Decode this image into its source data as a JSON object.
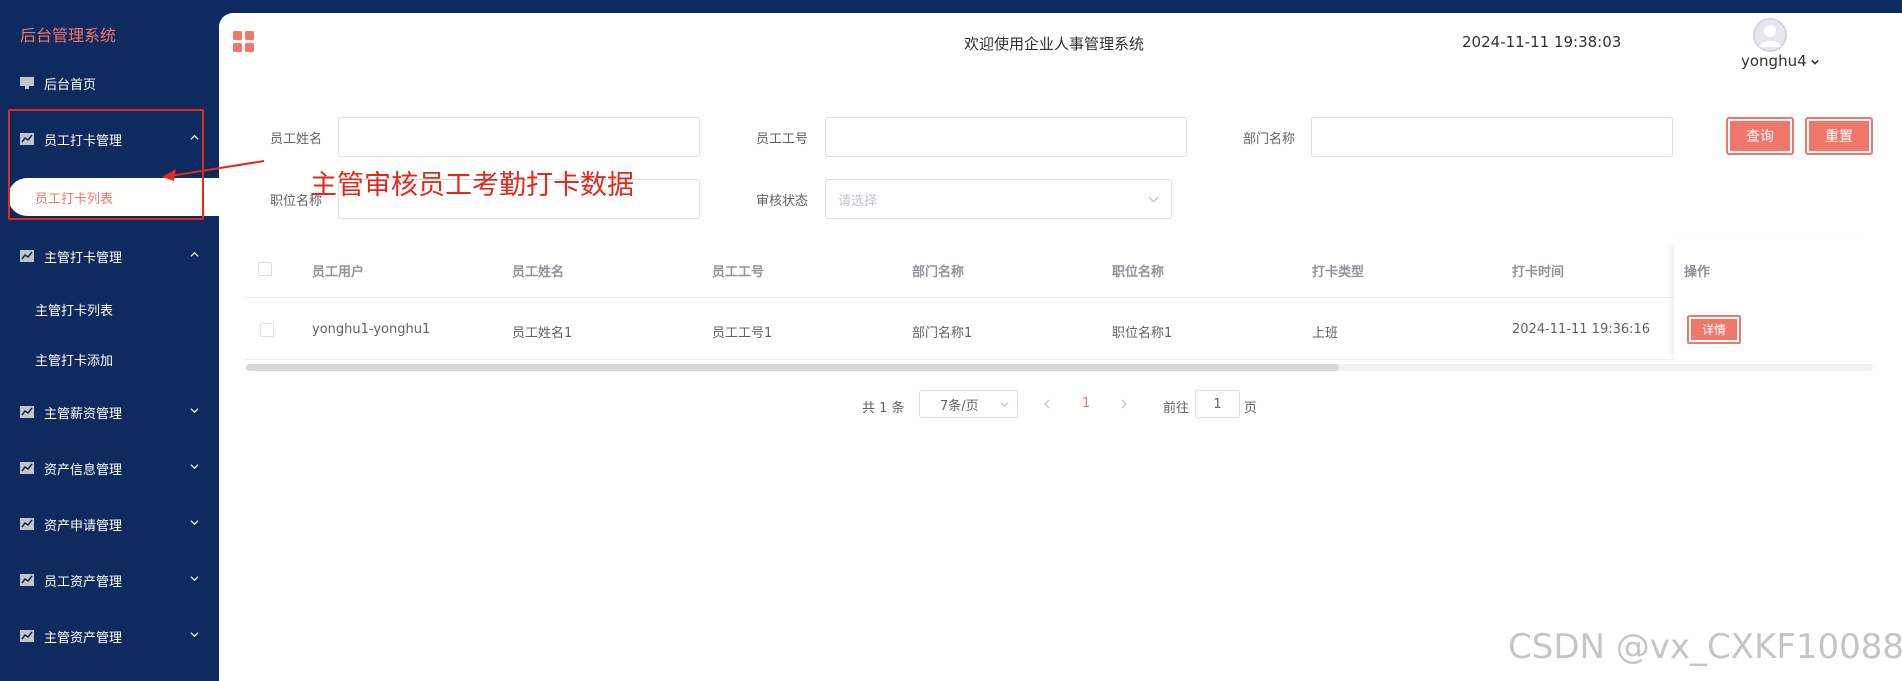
{
  "sidebar": {
    "brand": "后台管理系统",
    "items": [
      {
        "label": "后台首页",
        "icon": "monitor-icon"
      },
      {
        "label": "员工打卡管理",
        "icon": "chart-icon",
        "expanded": true,
        "children": [
          {
            "label": "员工打卡列表",
            "active": true
          }
        ]
      },
      {
        "label": "主管打卡管理",
        "icon": "chart-icon",
        "expanded": true,
        "children": [
          {
            "label": "主管打卡列表"
          },
          {
            "label": "主管打卡添加"
          }
        ]
      },
      {
        "label": "主管薪资管理",
        "icon": "chart-icon"
      },
      {
        "label": "资产信息管理",
        "icon": "chart-icon"
      },
      {
        "label": "资产申请管理",
        "icon": "chart-icon"
      },
      {
        "label": "员工资产管理",
        "icon": "chart-icon"
      },
      {
        "label": "主管资产管理",
        "icon": "chart-icon"
      }
    ]
  },
  "header": {
    "welcome": "欢迎使用企业人事管理系统",
    "datetime": "2024-11-11 19:38:03",
    "username": "yonghu4"
  },
  "search": {
    "employee_name_label": "员工姓名",
    "employee_no_label": "员工工号",
    "dept_label": "部门名称",
    "position_label": "职位名称",
    "status_label": "审核状态",
    "status_placeholder": "请选择",
    "query_button": "查询",
    "reset_button": "重置"
  },
  "annotation": {
    "text": "主管审核员工考勤打卡数据"
  },
  "table": {
    "columns": [
      "员工用户",
      "员工姓名",
      "员工工号",
      "部门名称",
      "职位名称",
      "打卡类型",
      "打卡时间",
      "操作"
    ],
    "rows": [
      {
        "user": "yonghu1-yonghu1",
        "name": "员工姓名1",
        "no": "员工工号1",
        "dept": "部门名称1",
        "position": "职位名称1",
        "type": "上班",
        "time": "2024-11-11 19:36:16",
        "action": "详情"
      }
    ]
  },
  "pagination": {
    "total_text": "共 1 条",
    "page_size": "7条/页",
    "current_page": "1",
    "goto_label": "前往",
    "goto_value": "1",
    "page_suffix": "页"
  },
  "watermark": "CSDN @vx_CXKF10088",
  "colors": {
    "sidebar_bg": "#0e2a5e",
    "accent": "#f0776a",
    "annotation_red": "#e02a1e"
  }
}
